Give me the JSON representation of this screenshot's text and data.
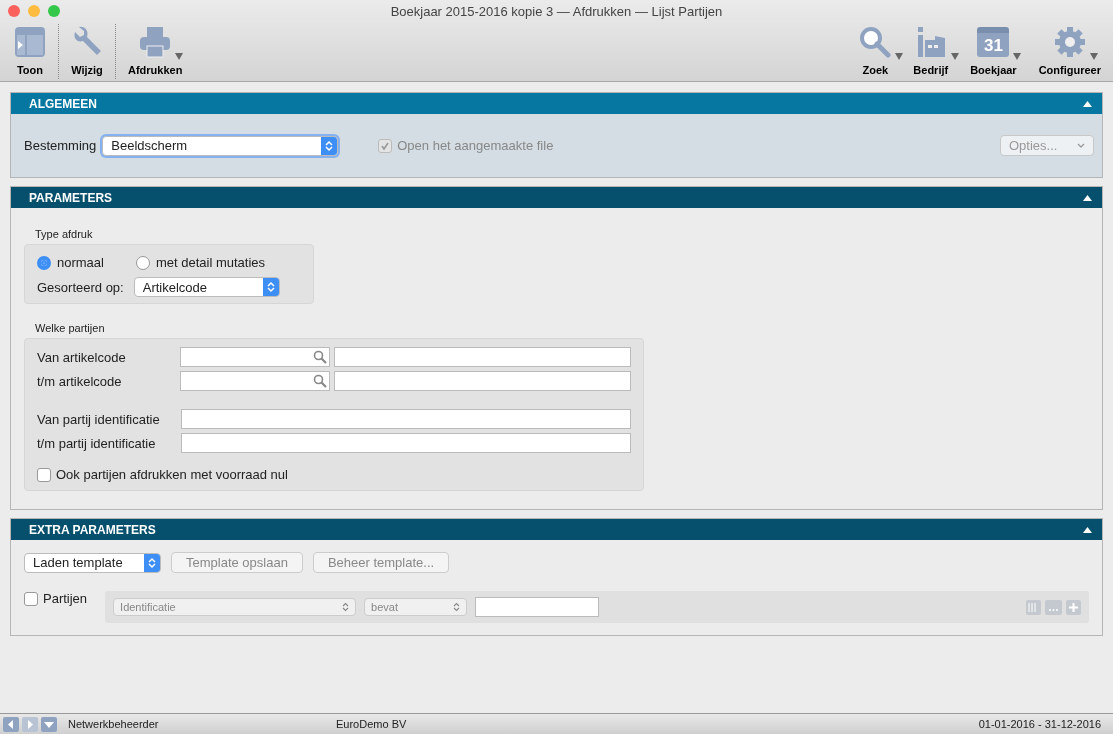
{
  "window": {
    "title": "Boekjaar 2015-2016 kopie 3 — Afdrukken — Lijst Partijen"
  },
  "toolbar": {
    "left": [
      {
        "kind": "panel",
        "label": "Toon",
        "dropdown": false
      },
      {
        "kind": "wrench",
        "label": "Wijzig",
        "dropdown": false
      },
      {
        "kind": "printer",
        "label": "Afdrukken",
        "dropdown": true
      }
    ],
    "right": [
      {
        "kind": "search",
        "label": "Zoek",
        "dropdown": true
      },
      {
        "kind": "factory",
        "label": "Bedrijf",
        "dropdown": true
      },
      {
        "kind": "calendar",
        "label": "Boekjaar",
        "dropdown": true,
        "icon_text": "31"
      },
      {
        "kind": "gear",
        "label": "Configureer",
        "dropdown": true
      }
    ]
  },
  "algemeen": {
    "title": "ALGEMEEN",
    "expanded": true,
    "destination_label": "Bestemming",
    "destination": "Beeldscherm",
    "open_file": {
      "label": "Open het aangemaakte file",
      "checked": true,
      "disabled": true
    },
    "options_button": {
      "label": "Opties...",
      "disabled": true
    }
  },
  "parameters": {
    "title": "PARAMETERS",
    "expanded": true,
    "print_type": {
      "label": "Type afdruk",
      "radios": [
        {
          "label": "normaal",
          "selected": true
        },
        {
          "label": "met detail mutaties",
          "selected": false
        }
      ],
      "sort_label": "Gesorteerd op:",
      "sort_value": "Artikelcode"
    },
    "which": {
      "label": "Welke partijen",
      "code_rows": [
        {
          "label": "Van artikelcode"
        },
        {
          "label": "t/m artikelcode"
        }
      ],
      "id_rows": [
        {
          "label": "Van partij identificatie"
        },
        {
          "label": "t/m partij identificatie"
        }
      ],
      "zero_stock": {
        "label": "Ook partijen afdrukken met voorraad nul",
        "checked": false
      }
    }
  },
  "extra": {
    "title": "EXTRA PARAMETERS",
    "expanded": true,
    "template_select": "Laden template",
    "buttons": [
      {
        "label": "Template opslaan",
        "disabled": true
      },
      {
        "label": "Beheer template...",
        "disabled": true
      }
    ],
    "filter": {
      "label": "Partijen",
      "checked": false,
      "field": "Identificatie",
      "operator": "bevat"
    }
  },
  "status_bar": {
    "user": "Netwerkbeheerder",
    "company": "EuroDemo BV",
    "period": "01-01-2016 - 31-12-2016"
  }
}
